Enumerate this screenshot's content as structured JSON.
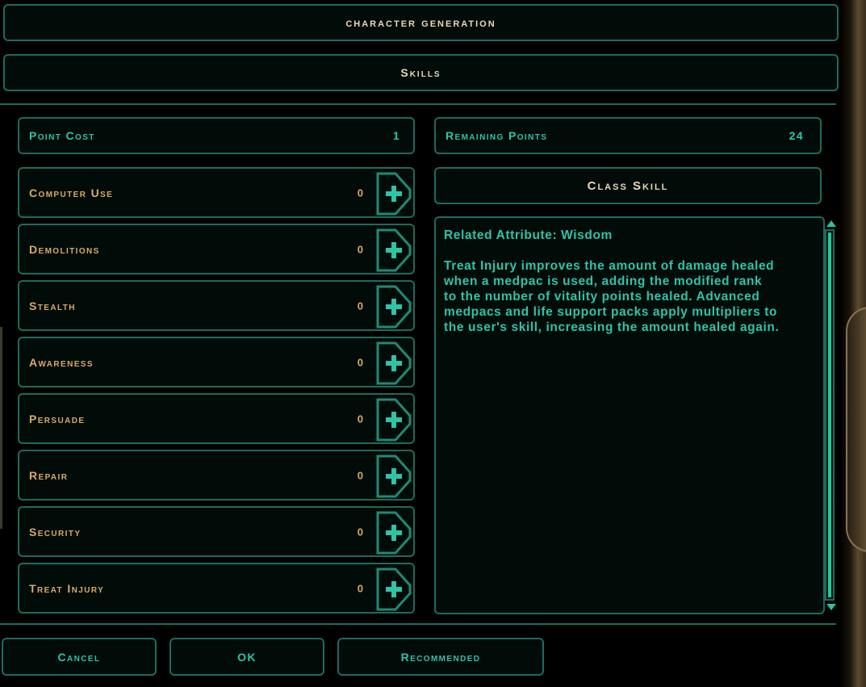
{
  "header": {
    "title": "character generation"
  },
  "subheader": {
    "title": "Skills"
  },
  "point_cost": {
    "label": "Point Cost",
    "value": "1"
  },
  "remaining_points": {
    "label": "Remaining Points",
    "value": "24"
  },
  "class_skill": {
    "label": "Class Skill"
  },
  "skills": [
    {
      "label": "Computer Use",
      "value": "0"
    },
    {
      "label": "Demolitions",
      "value": "0"
    },
    {
      "label": "Stealth",
      "value": "0"
    },
    {
      "label": "Awareness",
      "value": "0"
    },
    {
      "label": "Persuade",
      "value": "0"
    },
    {
      "label": "Repair",
      "value": "0"
    },
    {
      "label": "Security",
      "value": "0"
    },
    {
      "label": "Treat Injury",
      "value": "0"
    }
  ],
  "description": {
    "related_attribute": "Related Attribute: Wisdom",
    "body": "Treat Injury improves the amount of damage healed\nwhen a medpac is used, adding the modified rank\nto the number of vitality points healed. Advanced\nmedpacs and life support packs apply multipliers to\nthe user's skill, increasing the amount healed again."
  },
  "footer": {
    "cancel": "Cancel",
    "ok": "OK",
    "recommended": "Recommended"
  },
  "colors": {
    "border": "#1f6a5c",
    "amber": "#d9aa62",
    "teal": "#2fc3a8"
  },
  "icons": {
    "increment": "plus-icon",
    "scroll_up": "triangle-up-icon",
    "scroll_down": "triangle-down-icon"
  }
}
